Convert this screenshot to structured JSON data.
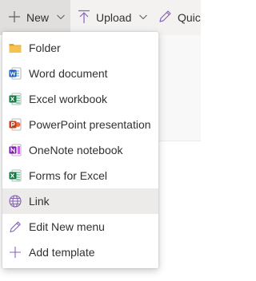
{
  "toolbar": {
    "new_label": "New",
    "upload_label": "Upload",
    "quick_label": "Quic"
  },
  "menu": {
    "items": [
      {
        "label": "Folder",
        "icon": "folder-icon"
      },
      {
        "label": "Word document",
        "icon": "word-icon"
      },
      {
        "label": "Excel workbook",
        "icon": "excel-icon"
      },
      {
        "label": "PowerPoint presentation",
        "icon": "powerpoint-icon"
      },
      {
        "label": "OneNote notebook",
        "icon": "onenote-icon"
      },
      {
        "label": "Forms for Excel",
        "icon": "forms-excel-icon"
      },
      {
        "label": "Link",
        "icon": "link-globe-icon",
        "selected": true
      },
      {
        "label": "Edit New menu",
        "icon": "pencil-icon"
      },
      {
        "label": "Add template",
        "icon": "plus-icon"
      }
    ]
  },
  "colors": {
    "folder": "#f6c24e",
    "word": "#185abd",
    "excel": "#107c41",
    "powerpoint": "#c43e1c",
    "onenote": "#7719aa",
    "accent": "#8764b8"
  }
}
